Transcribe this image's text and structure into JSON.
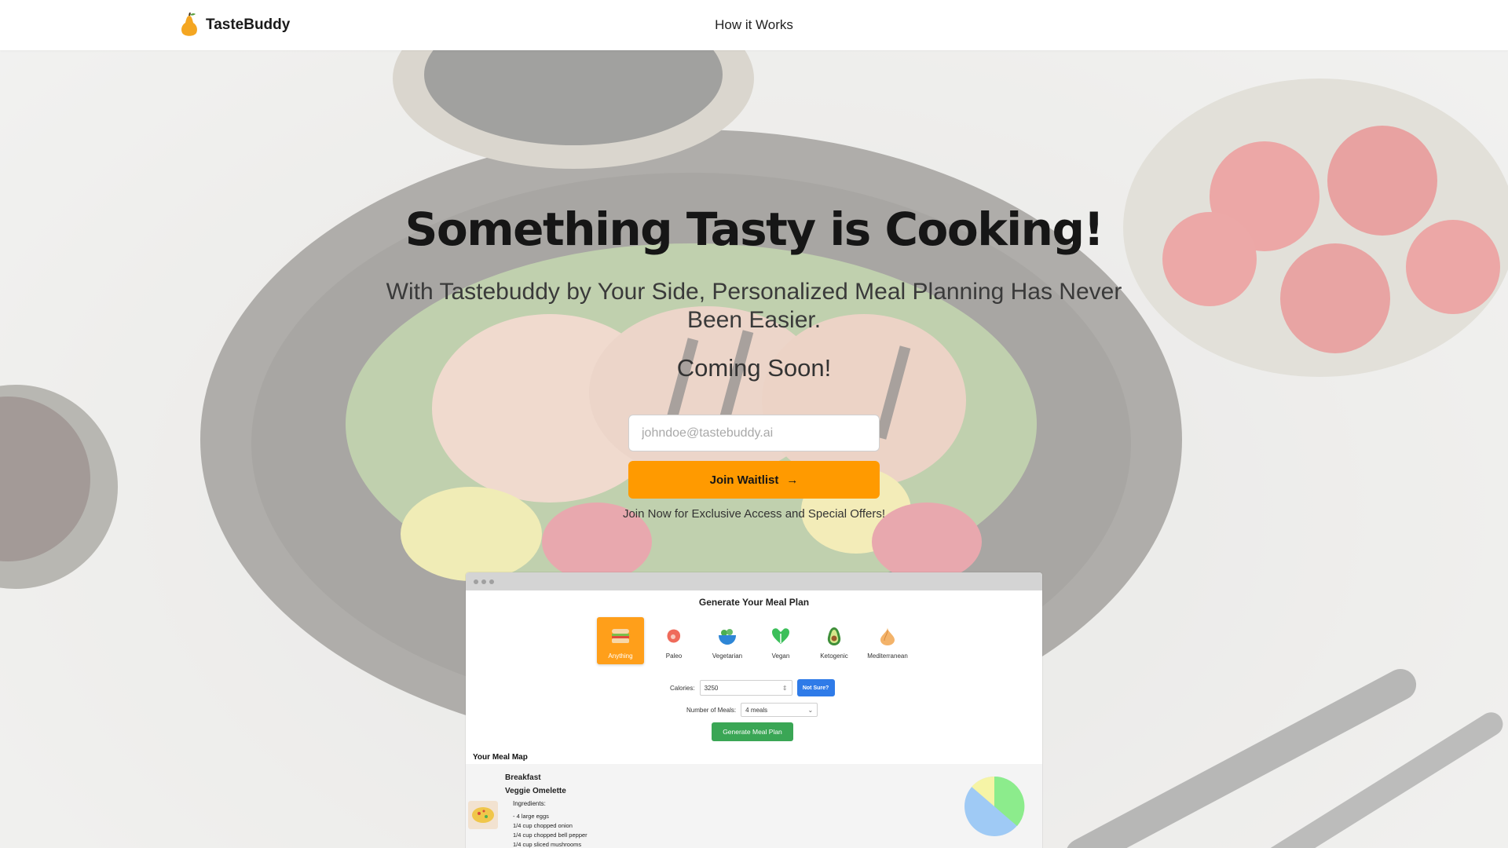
{
  "header": {
    "brand": "TasteBuddy",
    "nav_how_it_works": "How it Works"
  },
  "hero": {
    "title": "Something Tasty is Cooking!",
    "subtitle": "With Tastebuddy by Your Side, Personalized Meal Planning Has Never Been Easier.",
    "coming_soon": "Coming Soon!",
    "email_placeholder": "johndoe@tastebuddy.ai",
    "email_value": "",
    "join_button": "Join Waitlist",
    "join_note": "Join Now for Exclusive Access and Special Offers!"
  },
  "preview": {
    "title": "Generate Your Meal Plan",
    "diets": [
      {
        "label": "Anything",
        "icon": "sandwich-icon",
        "selected": true
      },
      {
        "label": "Paleo",
        "icon": "meat-icon",
        "selected": false
      },
      {
        "label": "Vegetarian",
        "icon": "salad-bowl-icon",
        "selected": false
      },
      {
        "label": "Vegan",
        "icon": "leaf-heart-icon",
        "selected": false
      },
      {
        "label": "Ketogenic",
        "icon": "avocado-icon",
        "selected": false
      },
      {
        "label": "Mediterranean",
        "icon": "onion-icon",
        "selected": false
      }
    ],
    "calories_label": "Calories:",
    "calories_value": "3250",
    "not_sure_button": "Not Sure?",
    "meals_label": "Number of Meals:",
    "meals_value": "4 meals",
    "generate_button": "Generate Meal Plan",
    "meal_map_title": "Your Meal Map",
    "meal": {
      "category": "Breakfast",
      "name": "Veggie Omelette",
      "ingredients_label": "Ingredients:",
      "ingredients": [
        "- 4 large eggs",
        "1/4 cup chopped onion",
        "1/4 cup chopped bell pepper",
        "1/4 cup sliced mushrooms"
      ]
    }
  },
  "colors": {
    "accent_orange": "#ff9a00",
    "blue_button": "#2f7be8",
    "green_button": "#3aa655"
  }
}
